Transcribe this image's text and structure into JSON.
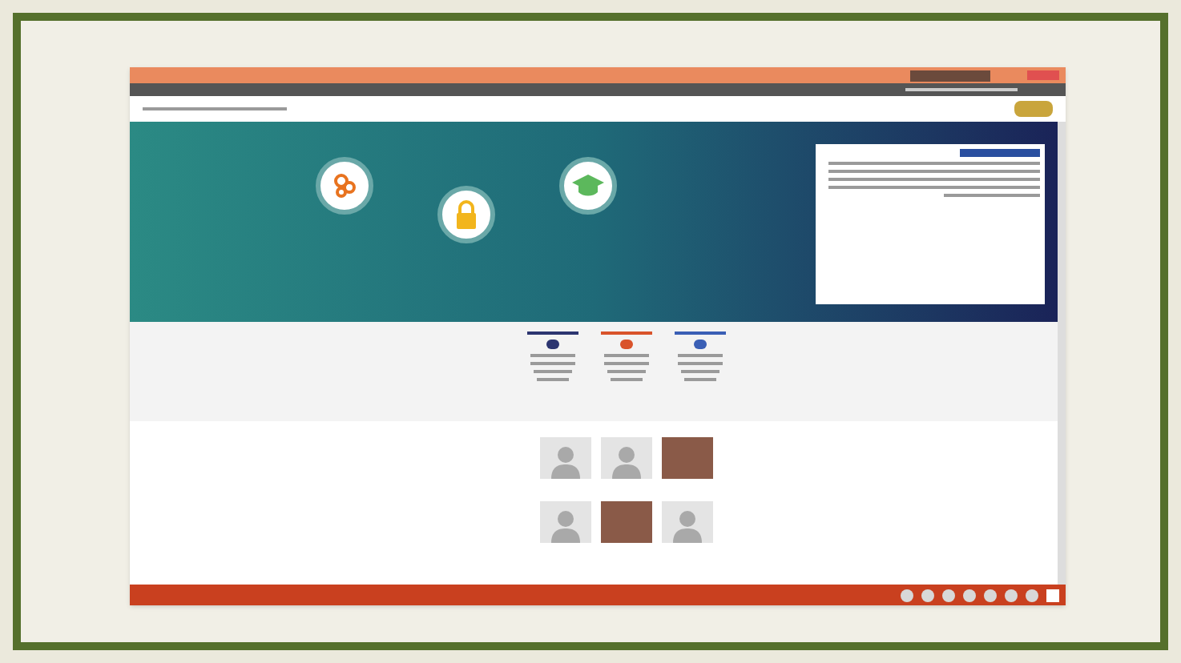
{
  "hero_steps": [
    {
      "kind": "gears"
    },
    {
      "kind": "lock"
    },
    {
      "kind": "cap"
    }
  ],
  "service_cards": [
    {
      "color": "#2c3570"
    },
    {
      "color": "#d9532b"
    },
    {
      "color": "#3a5fb5"
    }
  ],
  "people": [
    {
      "kind": "silhouette"
    },
    {
      "kind": "silhouette"
    },
    {
      "kind": "photo"
    },
    {
      "kind": "silhouette"
    },
    {
      "kind": "photo"
    },
    {
      "kind": "silhouette"
    }
  ],
  "taskbar_apps": [
    {
      "kind": "app"
    },
    {
      "kind": "app"
    },
    {
      "kind": "app"
    },
    {
      "kind": "app"
    },
    {
      "kind": "app"
    },
    {
      "kind": "app"
    },
    {
      "kind": "app"
    },
    {
      "kind": "start"
    }
  ]
}
